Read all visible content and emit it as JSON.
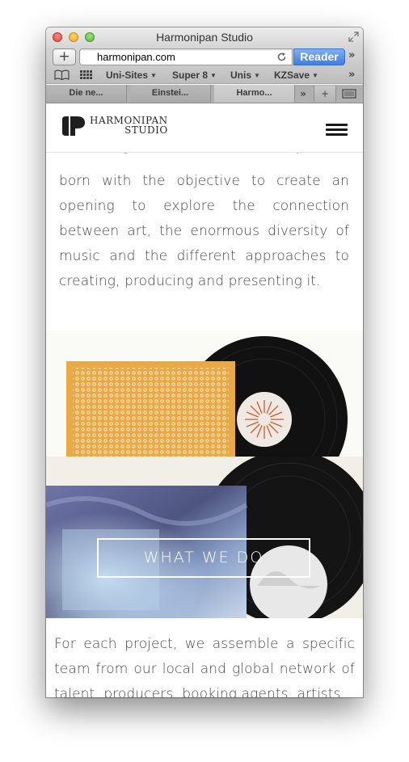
{
  "window": {
    "title": "Harmonipan Studio"
  },
  "toolbar": {
    "add_label": "+",
    "url": "harmonipan.com",
    "reader_label": "Reader",
    "overflow_label": "»"
  },
  "bookmarks": {
    "items": [
      {
        "label": "Uni-Sites"
      },
      {
        "label": "Super 8"
      },
      {
        "label": "Unis"
      },
      {
        "label": "KZSave"
      }
    ],
    "overflow_label": "»"
  },
  "tabs": {
    "items": [
      {
        "label": "Die ne..."
      },
      {
        "label": "Einstei..."
      },
      {
        "label": "Harmo..."
      }
    ],
    "overflow_label": "»",
    "new_tab_label": "+"
  },
  "site": {
    "logo_line1": "HARMONIPAN",
    "logo_line2": "STUDIO",
    "partial_text": "other organizations. Our concept was",
    "intro_text": "born with the objective to create an opening to explore the connection between art, the enormous diversity of music and the different approaches to creating, producing and presenting it.",
    "cta_label": "WHAT WE DO",
    "body_text": "For each project, we assemble a specific team from our local and global network of talent, producers, booking agents, artists,"
  },
  "colors": {
    "reader_button": "#3d7ee0",
    "text": "#4a4a4a",
    "cta_border": "#ffffff"
  }
}
